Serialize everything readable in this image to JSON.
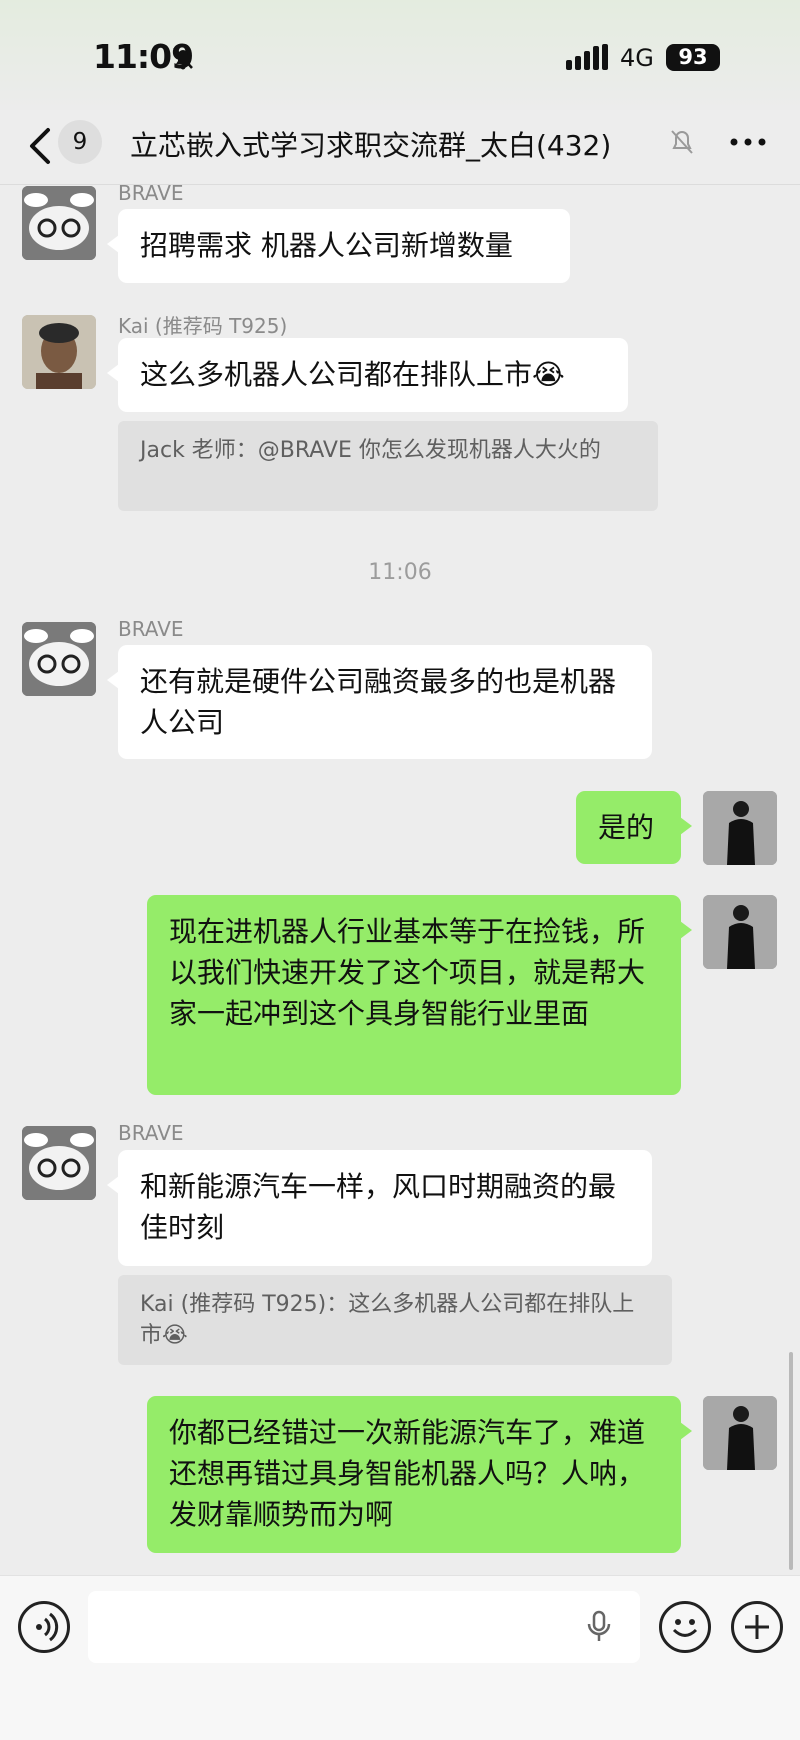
{
  "status_bar": {
    "time": "11:09",
    "network": "4G",
    "battery": "93"
  },
  "header": {
    "unread_count": "9",
    "title": "立芯嵌入式学习求职交流群_太白(432)"
  },
  "messages": [
    {
      "sender": "BRAVE",
      "text": "招聘需求 机器人公司新增数量"
    },
    {
      "sender": "Kai (推荐码 T925)",
      "text": "这么多机器人公司都在排队上市😭",
      "quote": "Jack 老师：@BRAVE 你怎么发现机器人大火的"
    },
    {
      "sender": "BRAVE",
      "text": "还有就是硬件公司融资最多的也是机器人公司"
    },
    {
      "text": "是的"
    },
    {
      "text": "现在进机器人行业基本等于在捡钱，所以我们快速开发了这个项目，就是帮大家一起冲到这个具身智能行业里面"
    },
    {
      "sender": "BRAVE",
      "text": "和新能源汽车一样，风口时期融资的最佳时刻",
      "quote": "Kai (推荐码 T925)：这么多机器人公司都在排队上市😭"
    },
    {
      "text": "你都已经错过一次新能源汽车了，难道还想再错过具身智能机器人吗？人呐，发财靠顺势而为啊"
    }
  ],
  "timestamp": "11:06",
  "input": {
    "value": ""
  },
  "icons": [
    "back-arrow-icon",
    "mute-bell-icon",
    "more-icon",
    "voice-icon",
    "mic-icon",
    "emoji-icon",
    "plus-icon"
  ],
  "colors": {
    "sent_bubble": "#95ec69",
    "received_bubble": "#ffffff",
    "background": "#ededed"
  }
}
